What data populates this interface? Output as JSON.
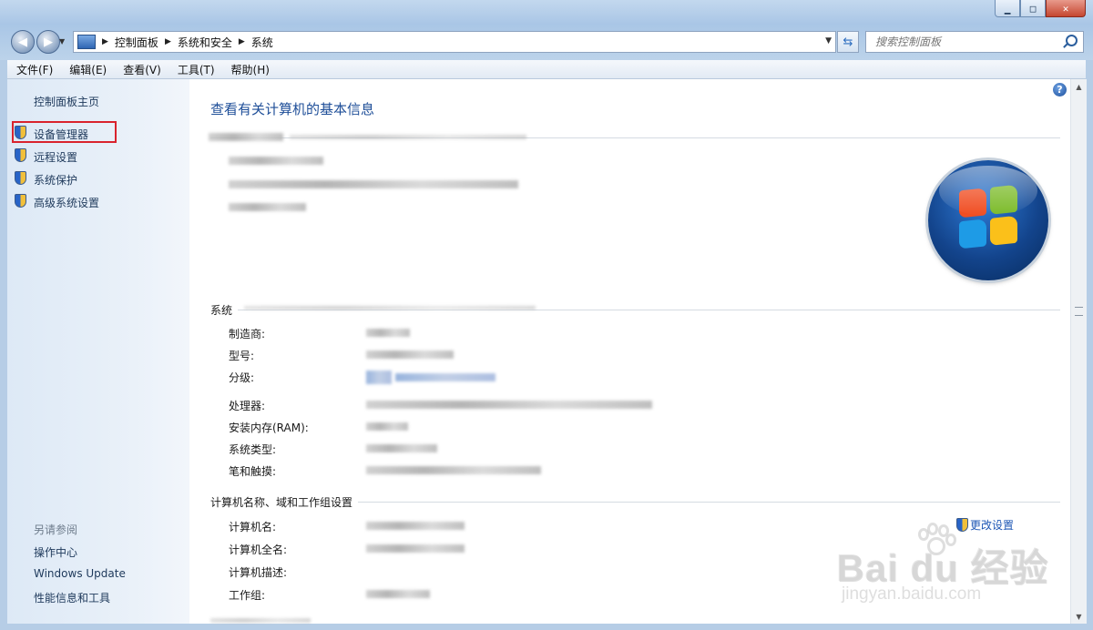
{
  "window": {
    "min_label": "▁",
    "max_label": "□",
    "close_label": "✕"
  },
  "nav": {
    "back_glyph": "◀",
    "forward_glyph": "▶",
    "breadcrumb": [
      "控制面板",
      "系统和安全",
      "系统"
    ],
    "search_placeholder": "搜索控制面板"
  },
  "menubar": [
    "文件(F)",
    "编辑(E)",
    "查看(V)",
    "工具(T)",
    "帮助(H)"
  ],
  "left_pane": {
    "home": "控制面板主页",
    "tasks": [
      "设备管理器",
      "远程设置",
      "系统保护",
      "高级系统设置"
    ],
    "see_also_title": "另请参阅",
    "see_also": [
      "操作中心",
      "Windows Update",
      "性能信息和工具"
    ]
  },
  "main": {
    "title": "查看有关计算机的基本信息",
    "system_section": "系统",
    "system_rows": [
      "制造商:",
      "型号:",
      "分级:",
      "处理器:",
      "安装内存(RAM):",
      "系统类型:",
      "笔和触摸:"
    ],
    "computer_section": "计算机名称、域和工作组设置",
    "computer_rows": [
      "计算机名:",
      "计算机全名:",
      "计算机描述:",
      "工作组:"
    ],
    "change_settings": "更改设置",
    "help_glyph": "?"
  },
  "watermark": {
    "text": "Bai du 经验",
    "sub": "jingyan.baidu.com"
  },
  "colors": {
    "link": "#1e395b",
    "title": "#1e4e98",
    "highlight": "#d9232d"
  }
}
